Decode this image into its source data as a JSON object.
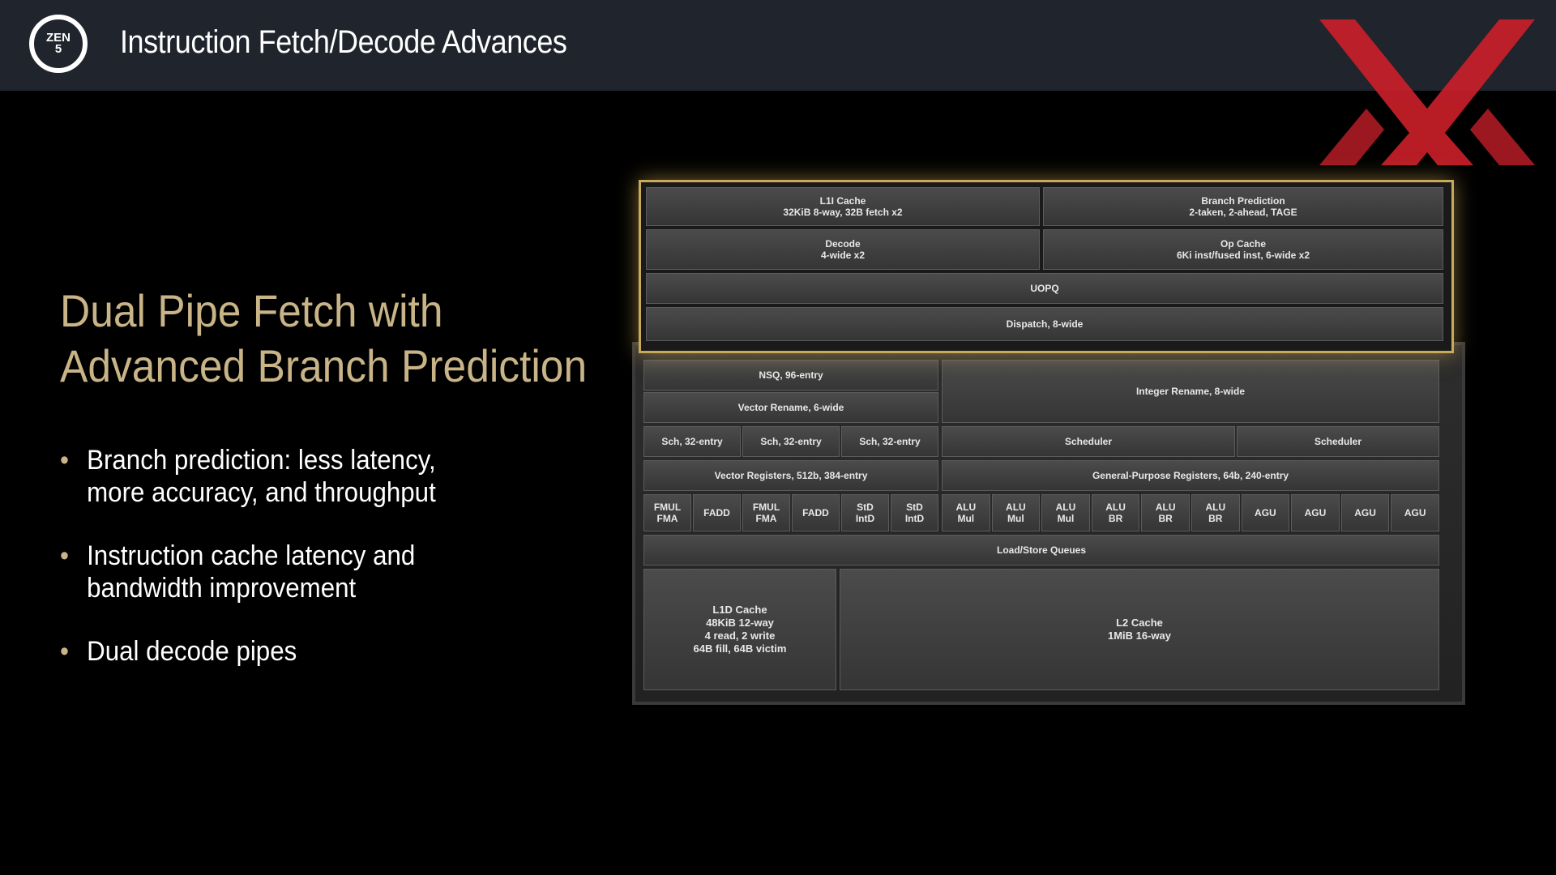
{
  "header": {
    "logo_text": "ZEN\n5",
    "title": "Instruction Fetch/Decode Advances"
  },
  "heading": {
    "line1": "Dual Pipe Fetch with",
    "line2": "Advanced Branch Prediction"
  },
  "bullets": [
    {
      "line1": "Branch prediction: less latency,",
      "line2": "more accuracy, and throughput"
    },
    {
      "line1": "Instruction cache latency and",
      "line2": "bandwidth improvement"
    },
    {
      "line1": "Dual decode pipes",
      "line2": ""
    }
  ],
  "diagram": {
    "l1i": "L1I Cache\n32KiB 8-way, 32B fetch x2",
    "bp": "Branch Prediction\n2-taken, 2-ahead, TAGE",
    "decode": "Decode\n4-wide x2",
    "opcache": "Op Cache\n6Ki inst/fused inst, 6-wide x2",
    "uopq": "UOPQ",
    "dispatch": "Dispatch, 8-wide",
    "nsq": "NSQ, 96-entry",
    "vrename": "Vector Rename, 6-wide",
    "irename": "Integer Rename, 8-wide",
    "sch1": "Sch, 32-entry",
    "sch2": "Sch, 32-entry",
    "sch3": "Sch, 32-entry",
    "scheduler1": "Scheduler",
    "scheduler2": "Scheduler",
    "vregs": "Vector Registers, 512b, 384-entry",
    "gpr": "General-Purpose Registers, 64b, 240-entry",
    "fp_units": [
      "FMUL\nFMA",
      "FADD",
      "FMUL\nFMA",
      "FADD",
      "StD\nIntD",
      "StD\nIntD"
    ],
    "int_units": [
      "ALU\nMul",
      "ALU\nMul",
      "ALU\nMul",
      "ALU\nBR",
      "ALU\nBR",
      "ALU\nBR",
      "AGU",
      "AGU",
      "AGU",
      "AGU"
    ],
    "lsq": "Load/Store Queues",
    "l1d": "L1D Cache\n48KiB 12-way\n4 read, 2 write\n64B fill, 64B victim",
    "l2": "L2 Cache\n1MiB 16-way"
  },
  "colors": {
    "accent_gold": "#c9b487",
    "header_bg": "#20242c",
    "watermark_red": "#c8202a"
  }
}
